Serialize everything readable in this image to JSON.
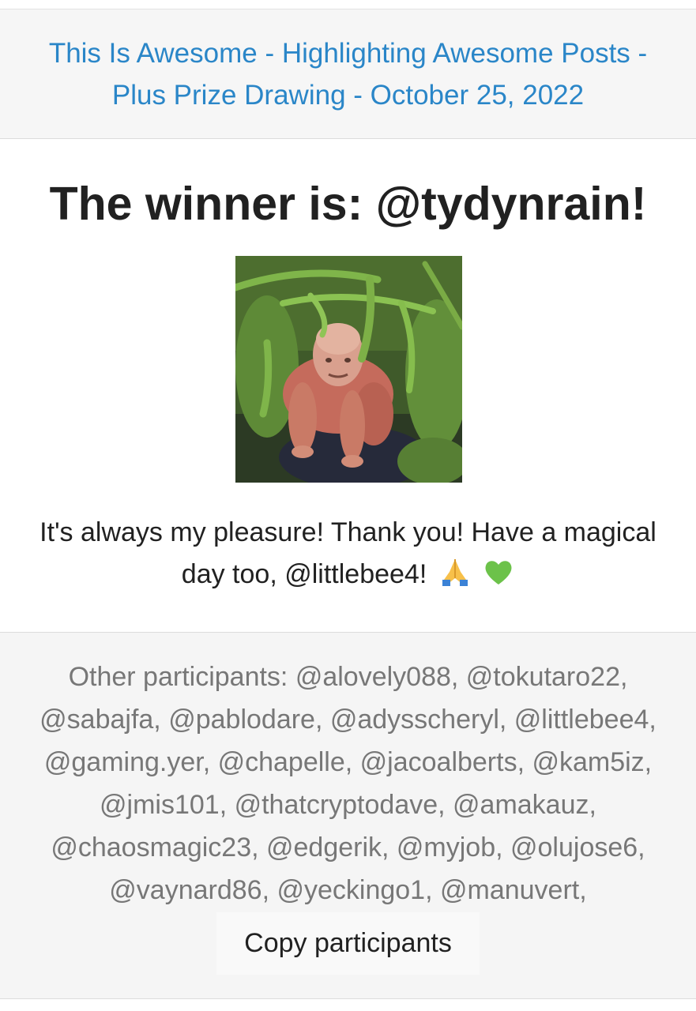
{
  "header": {
    "title_line1": "This Is Awesome - Highlighting Awesome Posts -",
    "title_line2": "Plus Prize Drawing - October 25, 2022"
  },
  "winner": {
    "heading": "The winner is: @tydynrain!",
    "avatar_alt": "avatar photo",
    "message": "It's always my pleasure! Thank you! Have a magical day too, @littlebee4!",
    "emojis": [
      "folded-hands-icon",
      "green-heart-icon"
    ]
  },
  "participants": {
    "text": "Other participants: @alovely088, @tokutaro22, @sabajfa, @pablodare, @adysscheryl, @littlebee4, @gaming.yer, @chapelle, @jacoalberts, @kam5iz, @jmis101, @thatcryptodave, @amakauz, @chaosmagic23, @edgerik, @myjob, @olujose6, @vaynard86, @yeckingo1, @manuvert,",
    "copy_button_label": "Copy participants"
  },
  "colors": {
    "link": "#2a86c8",
    "heading": "#212121",
    "muted_text": "#777777",
    "header_bg": "#f6f6f6",
    "footer_bg": "#f5f5f5"
  }
}
